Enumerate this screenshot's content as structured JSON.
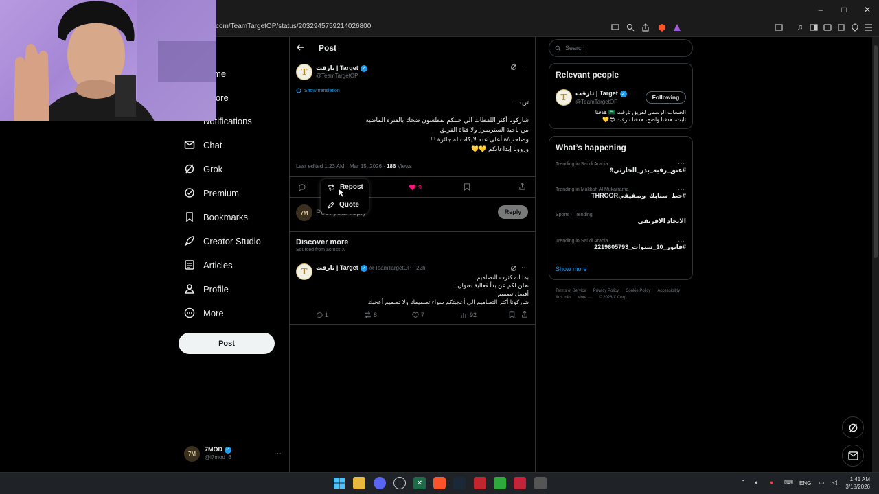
{
  "browser": {
    "url": "com/TeamTargetOP/status/2032945759214026800",
    "window_controls": [
      "–",
      "□",
      "✕"
    ]
  },
  "nav": {
    "items": [
      {
        "label": "Home",
        "visible": "me",
        "icon": "home-icon"
      },
      {
        "label": "Explore",
        "visible": "lore",
        "icon": "search-icon"
      },
      {
        "label": "Notifications",
        "icon": "bell-icon"
      },
      {
        "label": "Chat",
        "icon": "mail-icon"
      },
      {
        "label": "Grok",
        "icon": "grok-icon"
      },
      {
        "label": "Premium",
        "icon": "premium-icon"
      },
      {
        "label": "Bookmarks",
        "icon": "bookmark-icon"
      },
      {
        "label": "Creator Studio",
        "icon": "rocket-icon"
      },
      {
        "label": "Articles",
        "icon": "articles-icon"
      },
      {
        "label": "Profile",
        "icon": "person-icon"
      },
      {
        "label": "More",
        "icon": "more-circle-icon"
      }
    ],
    "post_button": "Post",
    "account": {
      "name": "7MOD",
      "handle": "@i7mod_6",
      "avatar": "7M"
    }
  },
  "main": {
    "header_title": "Post",
    "post": {
      "author": "تارقت | Target",
      "handle": "@TeamTargetOP",
      "show_translation": "Show translation",
      "lines": [
        "تريد :",
        "شاركونا أكثر اللقطات الي خلتكم تفطسون ضحك بالفترة الماضية",
        "من ناحية الستريمرز ولا قناة الفريق",
        "وصاحب/ة أعلى عدد لايكات له جائزة !!!",
        "وروونا إبداعاتكم 💛💛"
      ],
      "meta": "Last edited 1:23 AM · Mar 15, 2026 · ",
      "views_count": "186",
      "views_label": "Views",
      "likes": "9"
    },
    "repost_menu": {
      "repost": "Repost",
      "quote": "Quote"
    },
    "reply_box": {
      "placeholder": "Post your reply",
      "button": "Reply"
    },
    "discover": {
      "title": "Discover more",
      "subtitle": "Sourced from across X",
      "item": {
        "author": "تارقت | Target",
        "handle": "@TeamTargetOP · 22h",
        "lines": [
          "بما انه كثرت التصاميم",
          "نعلن لكم عن بدأ فعالية بعنوان :",
          "أفضل تصميم",
          "شاركونا أكثر التصاميم الي أعجبتكم سواء  تصميمك ولا تصميم أعجبك"
        ],
        "replies": "1",
        "reposts": "8",
        "likes": "7",
        "views": "92"
      }
    }
  },
  "right": {
    "search_placeholder": "Search",
    "relevant": {
      "title": "Relevant people",
      "name": "تارقت | Target",
      "handle": "@TeamTargetOP",
      "button": "Following",
      "bio1": "الحساب الرسمي لفريق تارقت 🇸🇦 هدفنا",
      "bio2": "ثابت، هدفنا واضح، هدفنا تارقت 😎💛"
    },
    "happening": {
      "title": "What’s happening",
      "trends": [
        {
          "category": "Trending in Saudi Arabia",
          "name": "#عنق_رقبه_بدر_الحارثي9"
        },
        {
          "category": "Trending in Makkah Al Mukarrama",
          "name": "#حط_سنابك_وصفيفيTHROOR"
        },
        {
          "category": "Sports · Trending",
          "name": "الاتحاد الافريقي"
        },
        {
          "category": "Trending in Saudi Arabia",
          "name": "#فانور_10_سنوات_2219605793"
        }
      ],
      "show_more": "Show more"
    },
    "footer": [
      "Terms of Service",
      "Privacy Policy",
      "Cookie Policy",
      "Accessibility",
      "Ads info",
      "More ···",
      "© 2026 X Corp."
    ]
  },
  "taskbar": {
    "lang": "ENG",
    "time": "1:41 AM",
    "date": "3/18/2026"
  }
}
